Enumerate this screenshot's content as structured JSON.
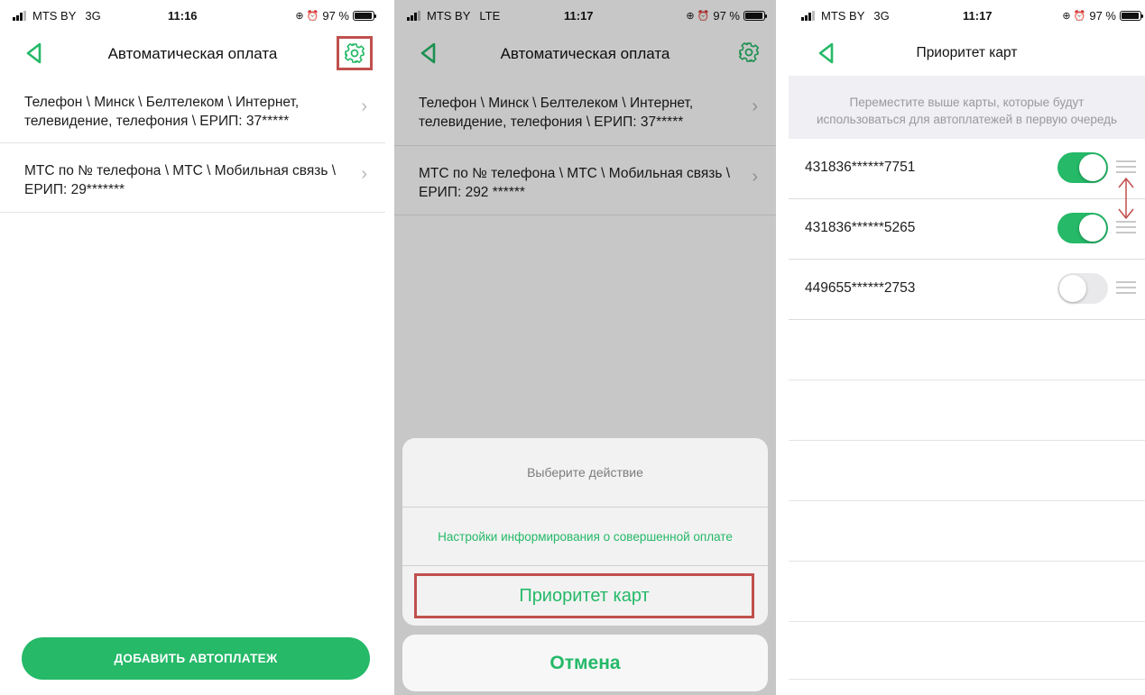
{
  "screen1": {
    "status": {
      "carrier": "MTS BY",
      "network": "3G",
      "time": "11:16",
      "battery": "97 %"
    },
    "title": "Автоматическая оплата",
    "items": [
      {
        "line1": "Телефон \\ Минск \\ Белтелеком \\ Интернет,",
        "line2": "телевидение, телефония \\ ЕРИП: 37*****"
      },
      {
        "line1": "МТС по № телефона \\ МТС \\ Мобильная связь \\",
        "line2": "ЕРИП: 29*******"
      }
    ],
    "add_button": "ДОБАВИТЬ АВТОПЛАТЕЖ"
  },
  "screen2": {
    "status": {
      "carrier": "MTS BY",
      "network": "LTE",
      "time": "11:17",
      "battery": "97 %"
    },
    "title": "Автоматическая оплата",
    "items": [
      {
        "line1": "Телефон \\ Минск \\ Белтелеком \\ Интернет,",
        "line2": "телевидение, телефония \\ ЕРИП: 37*****"
      },
      {
        "line1": "МТС по № телефона \\ МТС \\ Мобильная связь \\",
        "line2": "ЕРИП: 292 ******"
      }
    ],
    "sheet": {
      "title": "Выберите действие",
      "option_notify": "Настройки информирования о совершенной оплате",
      "option_priority": "Приоритет карт",
      "cancel": "Отмена"
    }
  },
  "screen3": {
    "status": {
      "carrier": "MTS BY",
      "network": "3G",
      "time": "11:17",
      "battery": "97 %"
    },
    "title": "Приоритет карт",
    "hint_line1": "Переместите выше карты, которые будут",
    "hint_line2": "использоваться для автоплатежей в первую очередь",
    "cards": [
      {
        "number": "431836******7751",
        "enabled": true
      },
      {
        "number": "431836******5265",
        "enabled": true
      },
      {
        "number": "449655******2753",
        "enabled": false
      }
    ]
  },
  "colors": {
    "accent": "#25b968",
    "highlight": "#c0504d"
  }
}
